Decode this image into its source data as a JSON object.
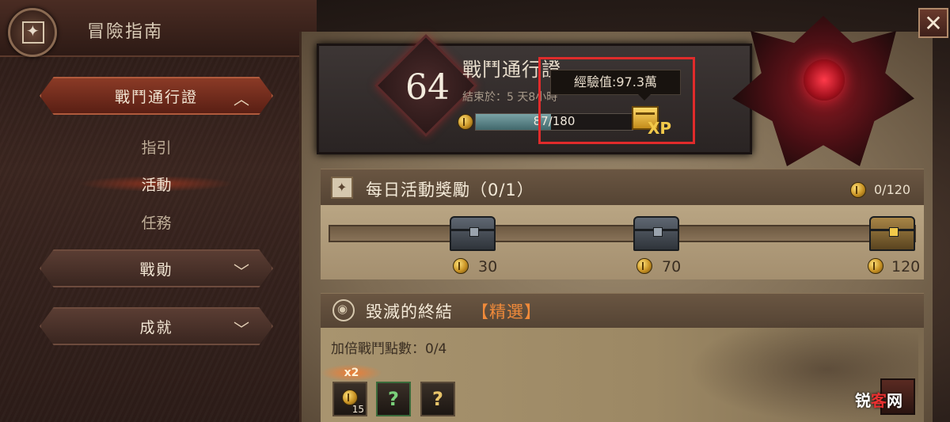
{
  "header": {
    "title": "冒險指南",
    "close_label": "✕"
  },
  "nav": {
    "battle_pass": "戰鬥通行證",
    "sub_items": [
      "指引",
      "活動",
      "任務"
    ],
    "battle_merit": "戰勛",
    "achievements": "成就"
  },
  "pass": {
    "level": "64",
    "title": "戰鬥通行證",
    "ends_in": "結束於：5 天8小時",
    "progress_text": "87/180",
    "progress_fraction": 0.48,
    "xp_label": "XP",
    "tooltip": "經驗值:97.3萬"
  },
  "daily": {
    "title": "每日活動獎勵（0/1）",
    "count": "0/120",
    "milestones": [
      "30",
      "70",
      "120"
    ]
  },
  "event": {
    "title": "毀滅的終結",
    "tag": "【精選】",
    "double_points": "加倍戰鬥點數：0/4",
    "multiplier": "x2",
    "item_qty": "15",
    "unknown_glyph": "?"
  },
  "watermark": {
    "part1": "锐",
    "part2": "客",
    "part3": "网"
  },
  "colors": {
    "accent_red": "#e02b2b",
    "tag_orange": "#f08a3a",
    "gold": "#f2c94a"
  }
}
